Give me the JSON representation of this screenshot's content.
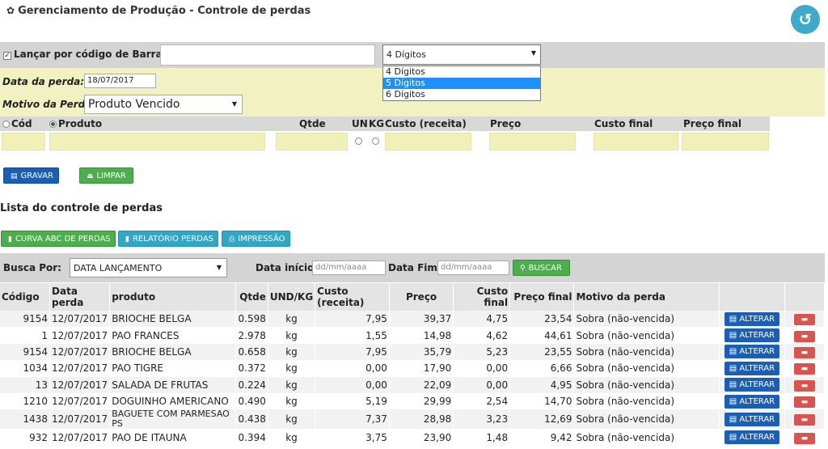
{
  "header": {
    "title": "Gerenciamento de Produção - Controle de perdas",
    "back_icon": "↺"
  },
  "form": {
    "barcode_label": "Lançar por código de Barras:",
    "barcode_value": "",
    "digits_selected": "4 Dígitos",
    "digits_options": [
      "4 Dígitos",
      "5 Dígitos",
      "6 Dígitos"
    ],
    "date_label": "Data da perda:",
    "date_value": "18/07/2017",
    "reason_label": "Motivo da Perda:",
    "reason_value": "Produto Vencido",
    "cols": {
      "cod": "Cód",
      "produto": "Produto",
      "qtde": "Qtde",
      "un": "UN",
      "kg": "KG",
      "custo": "Custo (receita)",
      "preco": "Preço",
      "custo_final": "Custo final",
      "preco_final": "Preço final"
    }
  },
  "actions": {
    "save": "GRAVAR",
    "clear": "LIMPAR"
  },
  "list": {
    "title": "Lista do controle de perdas",
    "btn_abc": "CURVA ABC DE PERDAS",
    "btn_report": "RELATÓRIO PERDAS",
    "btn_print": "IMPRESSÃO",
    "search_label": "Busca Por:",
    "search_value": "DATA LANÇAMENTO",
    "start_label": "Data início:",
    "start_placeholder": "dd/mm/aaaa",
    "end_label": "Data Fim:",
    "end_placeholder": "dd/mm/aaaa",
    "search_button": "BUSCAR",
    "edit_label": "ALTERAR"
  },
  "table": {
    "headers": [
      "Código",
      "Data perda",
      "produto",
      "Qtde",
      "UND/KG",
      "Custo (receita)",
      "Preço",
      "Custo final",
      "Preço final",
      "Motivo da perda",
      "",
      ""
    ],
    "rows": [
      [
        "9154",
        "12/07/2017",
        "BRIOCHE BELGA",
        "0.598",
        "kg",
        "7,95",
        "39,37",
        "4,75",
        "23,54",
        "Sobra (não-vencida)"
      ],
      [
        "1",
        "12/07/2017",
        "PAO FRANCES",
        "2.978",
        "kg",
        "1,55",
        "14,98",
        "4,62",
        "44,61",
        "Sobra (não-vencida)"
      ],
      [
        "9154",
        "12/07/2017",
        "BRIOCHE BELGA",
        "0.658",
        "kg",
        "7,95",
        "35,79",
        "5,23",
        "23,55",
        "Sobra (não-vencida)"
      ],
      [
        "1034",
        "12/07/2017",
        "PAO TIGRE",
        "0.372",
        "kg",
        "0,00",
        "17,90",
        "0,00",
        "6,66",
        "Sobra (não-vencida)"
      ],
      [
        "13",
        "12/07/2017",
        "SALADA DE FRUTAS",
        "0.224",
        "kg",
        "0,00",
        "22,09",
        "0,00",
        "4,95",
        "Sobra (não-vencida)"
      ],
      [
        "1210",
        "12/07/2017",
        "DOGUINHO AMERICANO",
        "0.490",
        "kg",
        "5,19",
        "29,99",
        "2,54",
        "14,70",
        "Sobra (não-vencida)"
      ],
      [
        "1438",
        "12/07/2017",
        "BAGUETE COM PARMESAO PS",
        "0.438",
        "kg",
        "7,37",
        "28,98",
        "3,23",
        "12,69",
        "Sobra (não-vencida)"
      ],
      [
        "932",
        "12/07/2017",
        "PAO DE ITAUNA",
        "0.394",
        "kg",
        "3,75",
        "23,90",
        "1,48",
        "9,42",
        "Sobra (não-vencida)"
      ]
    ]
  }
}
